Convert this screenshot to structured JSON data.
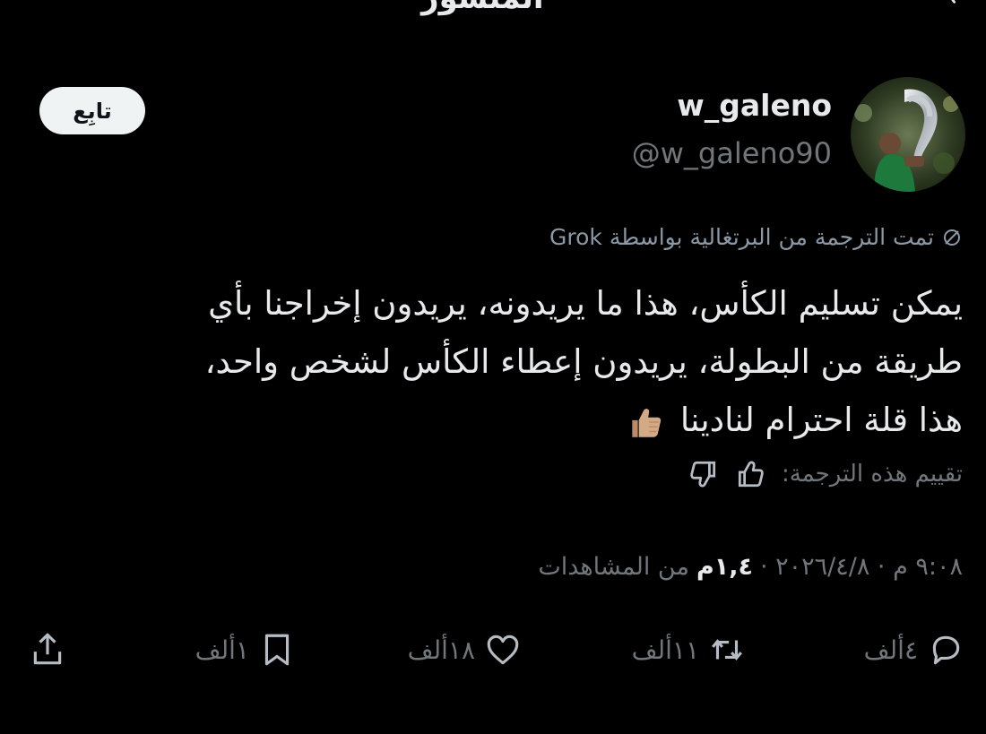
{
  "top": {
    "clipped_text": "المنشور"
  },
  "profile": {
    "display_name": "w_galeno",
    "handle": "@w_galeno90",
    "follow_label": "تابِع"
  },
  "translation": {
    "note": "تمت الترجمة من البرتغالية بواسطة Grok",
    "text_line1": "يمكن تسليم الكأس، هذا ما يريدونه، يريدون إخراجنا بأي",
    "text_line2": "طريقة من البطولة، يريدون إعطاء الكأس لشخص واحد،",
    "text_line3": "هذا قلة احترام لنادينا",
    "rate_label": "تقييم هذه الترجمة:"
  },
  "meta": {
    "timestamp": "٩:٠٨ م · ٢٠٢٦/٤/٨ ·",
    "views_count": "١,٤م",
    "views_label": "من المشاهدات"
  },
  "actions": {
    "replies": "٤ألف",
    "retweets": "١١ألف",
    "likes": "١٨ألف",
    "bookmarks": "١ألف"
  },
  "colors": {
    "background": "#000000",
    "text_primary": "#e7e9ea",
    "text_secondary": "#71767b",
    "follow_bg": "#eff3f4"
  },
  "icons": {
    "reply": "reply-icon",
    "retweet": "retweet-icon",
    "like": "heart-icon",
    "bookmark": "bookmark-icon",
    "share": "share-icon",
    "thumbs_up": "thumbs-up-icon",
    "thumbs_down": "thumbs-down-icon",
    "translate": "translate-icon"
  }
}
